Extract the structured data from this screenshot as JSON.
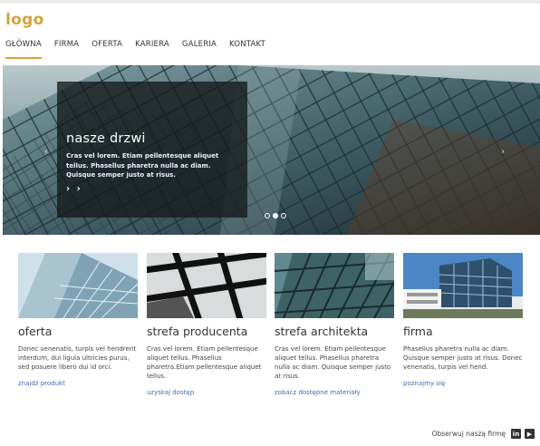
{
  "header": {
    "logo": "logo"
  },
  "nav": {
    "items": [
      {
        "label": "GŁÓWNA",
        "active": true
      },
      {
        "label": "FIRMA"
      },
      {
        "label": "OFERTA"
      },
      {
        "label": "KARIERA"
      },
      {
        "label": "GALERIA"
      },
      {
        "label": "KONTAKT"
      }
    ]
  },
  "slider": {
    "title": "nasze drzwi",
    "text": "Cras vel lorem. Etiam pellentesque aliquet tellus. Phasellus pharetra nulla ac diam. Quisque semper justo at risus.",
    "more": "› ›",
    "prev": "‹",
    "next": "›",
    "slide_count": 3,
    "active_slide": 2
  },
  "cards": [
    {
      "title": "oferta",
      "text": "Donec venenatis, turpis vel hendrerit interdum, dui ligula ultricies purus, sed posuere libero dui id orci.",
      "link": "znajdź produkt"
    },
    {
      "title": "strefa producenta",
      "text": "Cras vel lorem. Etiam pellentesque aliquet tellus. Phasellus pharetra.Etiam pellentesque aliquet tellus.",
      "link": "uzyskaj dostęp"
    },
    {
      "title": "strefa architekta",
      "text": "Cras vel lorem. Etiam pellentesque aliquet tellus. Phasellus pharetra nulla ac diam. Quisque semper justo at risus.",
      "link": "zobacz dostępne materiały"
    },
    {
      "title": "firma",
      "text": "Phasellus pharetra nulla ac diam. Quisque semper justo at risus. Donec venenatis, turpis vel hend.",
      "link": "poznajmy się"
    }
  ],
  "footer": {
    "follow": "Obserwuj naszą firmę",
    "linkedin": "in",
    "youtube": "▶"
  },
  "colors": {
    "accent": "#d4a33c",
    "link": "#3a6fb0"
  }
}
